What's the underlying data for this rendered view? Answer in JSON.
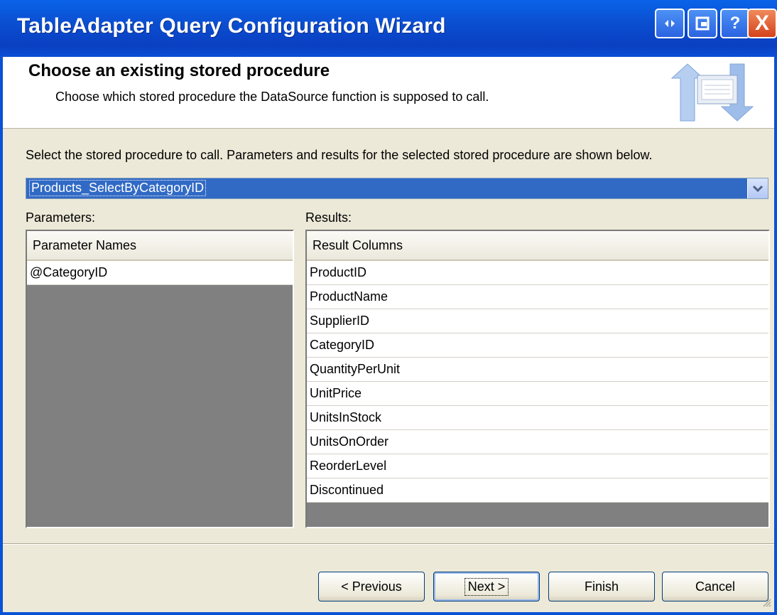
{
  "window": {
    "title": "TableAdapter Query Configuration Wizard",
    "title_buttons": [
      "restore-icon",
      "maximize-icon",
      "help-icon",
      "close-icon"
    ],
    "help_label": "?",
    "close_label": "X"
  },
  "header": {
    "title": "Choose an existing stored procedure",
    "subtitle": "Choose which stored procedure the DataSource function is supposed to call."
  },
  "main": {
    "prompt": "Select the stored procedure to call. Parameters and results for the selected stored procedure are shown below.",
    "procedure_select": {
      "value": "Products_SelectByCategoryID"
    },
    "parameters": {
      "label": "Parameters:",
      "column_header": "Parameter Names",
      "rows": [
        "@CategoryID"
      ]
    },
    "results": {
      "label": "Results:",
      "column_header": "Result Columns",
      "rows": [
        "ProductID",
        "ProductName",
        "SupplierID",
        "CategoryID",
        "QuantityPerUnit",
        "UnitPrice",
        "UnitsInStock",
        "UnitsOnOrder",
        "ReorderLevel",
        "Discontinued"
      ]
    }
  },
  "footer": {
    "previous_label": "< Previous",
    "next_label": "Next >",
    "finish_label": "Finish",
    "cancel_label": "Cancel"
  },
  "colors": {
    "titlebar": "#0b4fd1",
    "selection": "#316ac5",
    "dialog_bg": "#ece9d8",
    "grid_bg": "#808080"
  }
}
